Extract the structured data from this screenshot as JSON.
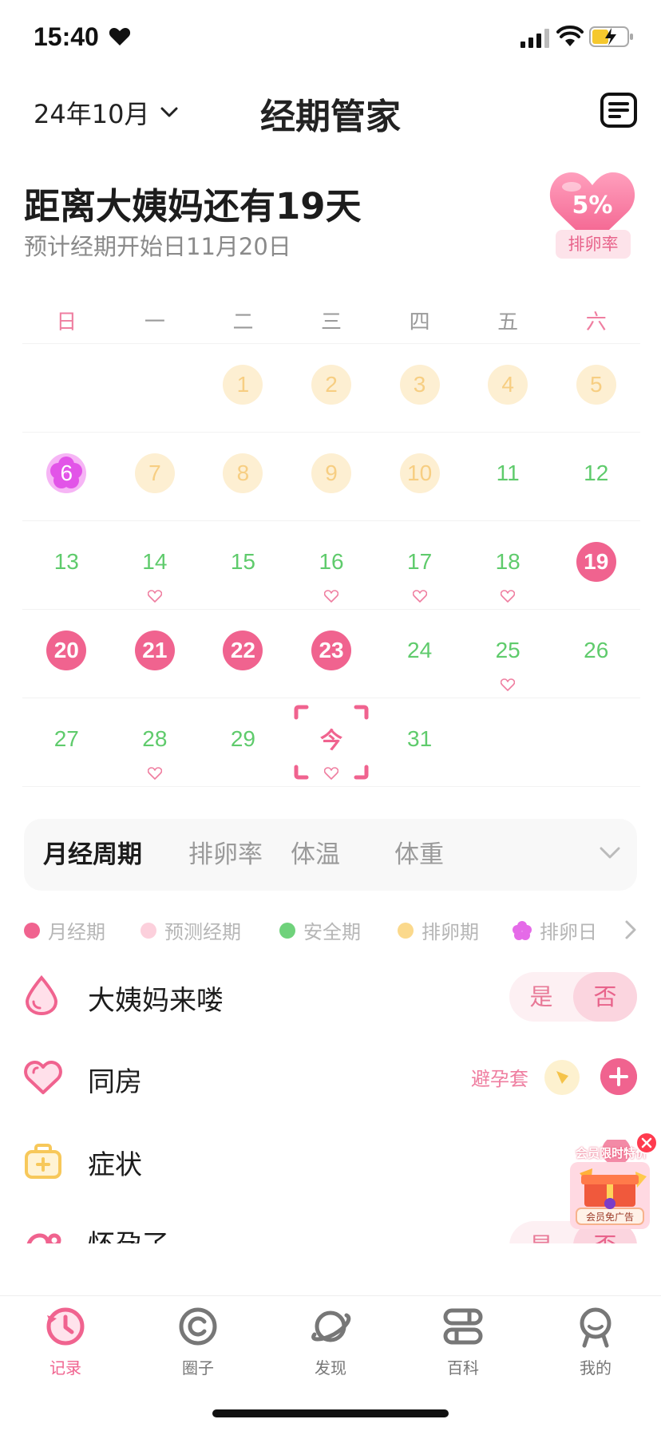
{
  "status_bar": {
    "time": "15:40"
  },
  "header": {
    "month": "24年10月",
    "title": "经期管家"
  },
  "countdown": {
    "title": "距离大姨妈还有19天",
    "subtitle": "预计经期开始日11月20日"
  },
  "ovulation_badge": {
    "percent": "5%",
    "label": "排卵率"
  },
  "calendar": {
    "weekdays": [
      "日",
      "一",
      "二",
      "三",
      "四",
      "五",
      "六"
    ],
    "weeks": [
      [
        {
          "day": "",
          "status": "blank"
        },
        {
          "day": "",
          "status": "blank"
        },
        {
          "day": "1",
          "status": "fertile"
        },
        {
          "day": "2",
          "status": "fertile"
        },
        {
          "day": "3",
          "status": "fertile"
        },
        {
          "day": "4",
          "status": "fertile"
        },
        {
          "day": "5",
          "status": "fertile"
        }
      ],
      [
        {
          "day": "6",
          "status": "ovulation"
        },
        {
          "day": "7",
          "status": "fertile"
        },
        {
          "day": "8",
          "status": "fertile"
        },
        {
          "day": "9",
          "status": "fertile"
        },
        {
          "day": "10",
          "status": "fertile"
        },
        {
          "day": "11",
          "status": "safe"
        },
        {
          "day": "12",
          "status": "safe"
        }
      ],
      [
        {
          "day": "13",
          "status": "safe"
        },
        {
          "day": "14",
          "status": "safe",
          "heart": true
        },
        {
          "day": "15",
          "status": "safe"
        },
        {
          "day": "16",
          "status": "safe",
          "heart": true
        },
        {
          "day": "17",
          "status": "safe",
          "heart": true
        },
        {
          "day": "18",
          "status": "safe",
          "heart": true
        },
        {
          "day": "19",
          "status": "period"
        }
      ],
      [
        {
          "day": "20",
          "status": "period"
        },
        {
          "day": "21",
          "status": "period"
        },
        {
          "day": "22",
          "status": "period"
        },
        {
          "day": "23",
          "status": "period"
        },
        {
          "day": "24",
          "status": "safe"
        },
        {
          "day": "25",
          "status": "safe",
          "heart": true
        },
        {
          "day": "26",
          "status": "safe"
        }
      ],
      [
        {
          "day": "27",
          "status": "safe"
        },
        {
          "day": "28",
          "status": "safe",
          "heart": true
        },
        {
          "day": "29",
          "status": "safe"
        },
        {
          "day": "今",
          "status": "today",
          "heart": true
        },
        {
          "day": "31",
          "status": "safe"
        },
        {
          "day": "",
          "status": "blank"
        },
        {
          "day": "",
          "status": "blank"
        }
      ]
    ]
  },
  "tabs": [
    "月经周期",
    "排卵率",
    "体温",
    "体重"
  ],
  "legend": [
    {
      "label": "月经期",
      "color": "#f0638f"
    },
    {
      "label": "预测经期",
      "color": "#fcd0dc"
    },
    {
      "label": "安全期",
      "color": "#6fd27b"
    },
    {
      "label": "排卵期",
      "color": "#fbd98c"
    },
    {
      "label": "排卵日",
      "color": "#e56be8"
    }
  ],
  "records": {
    "period": {
      "label": "大姨妈来喽",
      "yes": "是",
      "no": "否"
    },
    "intimacy": {
      "label": "同房",
      "condom": "避孕套"
    },
    "symptoms": {
      "label": "症状"
    },
    "pregnancy": {
      "label": "怀孕了",
      "yes": "是",
      "no": "否"
    }
  },
  "ad": {
    "title": "会员限时特价",
    "footer": "会员免广告",
    "badge": "抢"
  },
  "bottom_nav": [
    {
      "label": "记录",
      "icon": "record-clock-icon"
    },
    {
      "label": "圈子",
      "icon": "circle-community-icon"
    },
    {
      "label": "发现",
      "icon": "planet-discover-icon"
    },
    {
      "label": "百科",
      "icon": "encyclopedia-icon"
    },
    {
      "label": "我的",
      "icon": "profile-icon"
    }
  ],
  "colors": {
    "accent": "#f0638f",
    "safe": "#5fcb6c",
    "fertile": "#f7ce82",
    "ovulation": "#e56be8"
  }
}
